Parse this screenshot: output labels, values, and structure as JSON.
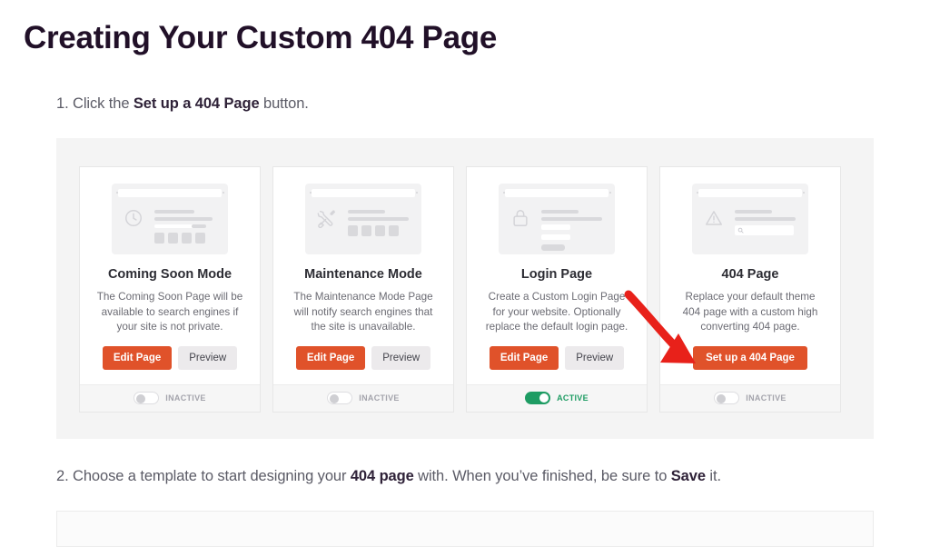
{
  "page": {
    "title": "Creating Your Custom 404 Page"
  },
  "steps": [
    {
      "id": "step-1",
      "prefix": "1. Click the ",
      "emphasis": "Set up a 404 Page",
      "suffix": " button."
    },
    {
      "id": "step-2",
      "prefix": "2. Choose a template to start designing your ",
      "emphasis": "404 page",
      "middle": " with. When you’ve finished, be sure to ",
      "emphasis2": "Save",
      "suffix": " it."
    }
  ],
  "colors": {
    "primary_button": "#e0522a",
    "secondary_button": "#eceaec",
    "active_green": "#1e9c63",
    "inactive_gray": "#a4a4ac",
    "arrow_red": "#e8211a",
    "container_bg": "#f4f4f4",
    "title_text": "#211028"
  },
  "cards": [
    {
      "id": "coming-soon-mode",
      "icon": "clock-icon",
      "title": "Coming Soon Mode",
      "description": "The Coming Soon Page will be available to search engines if your site is not private.",
      "buttons": [
        {
          "name": "edit-page-button",
          "label": "Edit Page",
          "style": "primary"
        },
        {
          "name": "preview-button",
          "label": "Preview",
          "style": "secondary"
        }
      ],
      "status": {
        "label": "INACTIVE",
        "state": "off"
      }
    },
    {
      "id": "maintenance-mode",
      "icon": "tools-icon",
      "title": "Maintenance Mode",
      "description": "The Maintenance Mode Page will notify search engines that the site is unavailable.",
      "buttons": [
        {
          "name": "edit-page-button",
          "label": "Edit Page",
          "style": "primary"
        },
        {
          "name": "preview-button",
          "label": "Preview",
          "style": "secondary"
        }
      ],
      "status": {
        "label": "INACTIVE",
        "state": "off"
      }
    },
    {
      "id": "login-page",
      "icon": "lock-icon",
      "title": "Login Page",
      "description": "Create a Custom Login Page for your website. Optionally replace the default login page.",
      "buttons": [
        {
          "name": "edit-page-button",
          "label": "Edit Page",
          "style": "primary"
        },
        {
          "name": "preview-button",
          "label": "Preview",
          "style": "secondary"
        }
      ],
      "status": {
        "label": "ACTIVE",
        "state": "on"
      }
    },
    {
      "id": "404-page",
      "icon": "warning-triangle-icon",
      "title": "404 Page",
      "description": "Replace your default theme 404 page with a custom high converting 404 page.",
      "buttons": [
        {
          "name": "set-up-404-page-button",
          "label": "Set up a 404 Page",
          "style": "primary"
        }
      ],
      "status": {
        "label": "INACTIVE",
        "state": "off"
      }
    }
  ],
  "annotation": {
    "name": "red-arrow-annotation",
    "points_to": "set-up-404-page-button"
  }
}
